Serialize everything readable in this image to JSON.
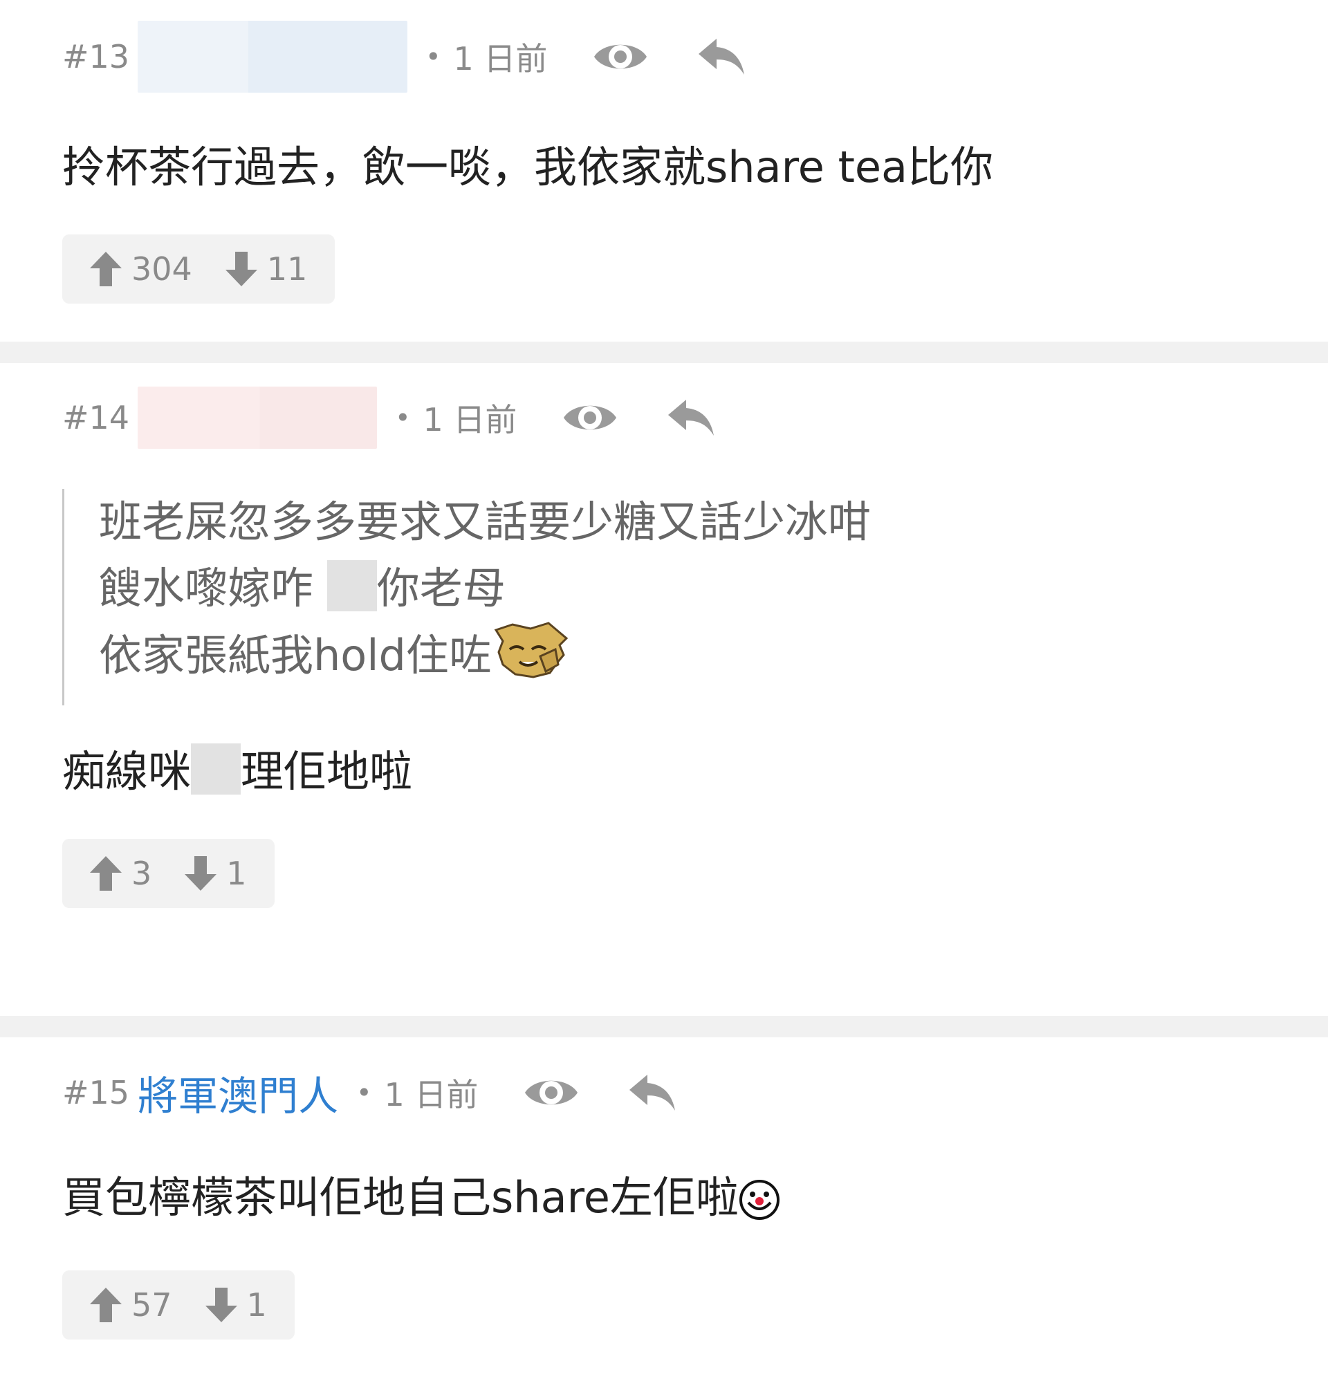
{
  "posts": [
    {
      "number": "#13",
      "username": "",
      "time": "1 日前",
      "content": "拎杯茶行過去，飲一啖，我依家就share tea比你",
      "upvotes": "304",
      "downvotes": "11"
    },
    {
      "number": "#14",
      "username": "",
      "time": "1 日前",
      "quote_line1": "班老屎忽多多要求又話要少糖又話少冰咁",
      "quote_line2a": "餿水嚟嫁咋",
      "quote_line2b": "你老母",
      "quote_line3": "依家張紙我hold住咗",
      "content_a": "痴線咪",
      "content_b": "理佢地啦",
      "upvotes": "3",
      "downvotes": "1"
    },
    {
      "number": "#15",
      "username": "將軍澳門人",
      "time": "1 日前",
      "content": "買包檸檬茶叫佢地自己share左佢啦",
      "upvotes": "57",
      "downvotes": "1"
    }
  ],
  "icons": {
    "view": "eye-icon",
    "reply": "reply-icon",
    "upvote": "arrow-up-icon",
    "downvote": "arrow-down-icon"
  },
  "colors": {
    "username": "#2f7fd0",
    "meta": "#8a8a8a",
    "divider": "#f1f1f1",
    "vote_bg": "#f2f2f2"
  }
}
